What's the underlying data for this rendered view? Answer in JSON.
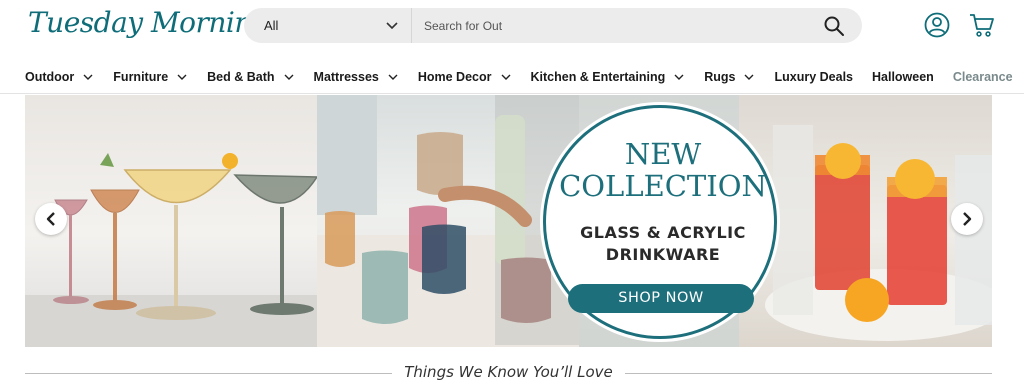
{
  "brand": {
    "logo_text": "Tuesday Morning",
    "color": "#0e6d78"
  },
  "search": {
    "category": "All",
    "placeholder": "Search for Out",
    "value": ""
  },
  "header_icons": [
    "account-icon",
    "cart-icon"
  ],
  "nav": {
    "items": [
      {
        "label": "Outdoor",
        "has_dropdown": true
      },
      {
        "label": "Furniture",
        "has_dropdown": true
      },
      {
        "label": "Bed & Bath",
        "has_dropdown": true
      },
      {
        "label": "Mattresses",
        "has_dropdown": true
      },
      {
        "label": "Home Decor",
        "has_dropdown": true
      },
      {
        "label": "Kitchen & Entertaining",
        "has_dropdown": true
      },
      {
        "label": "Rugs",
        "has_dropdown": true
      },
      {
        "label": "Luxury Deals",
        "has_dropdown": false
      },
      {
        "label": "Halloween",
        "has_dropdown": false
      },
      {
        "label": "Clearance",
        "has_dropdown": false
      }
    ]
  },
  "hero": {
    "title_line1": "NEW",
    "title_line2": "COLLECTION",
    "subtitle_line1": "GLASS & ACRYLIC",
    "subtitle_line2": "DRINKWARE",
    "cta": "SHOP NOW",
    "accent_color": "#1d6f7c"
  },
  "section": {
    "title": "Things We Know You’ll Love"
  }
}
